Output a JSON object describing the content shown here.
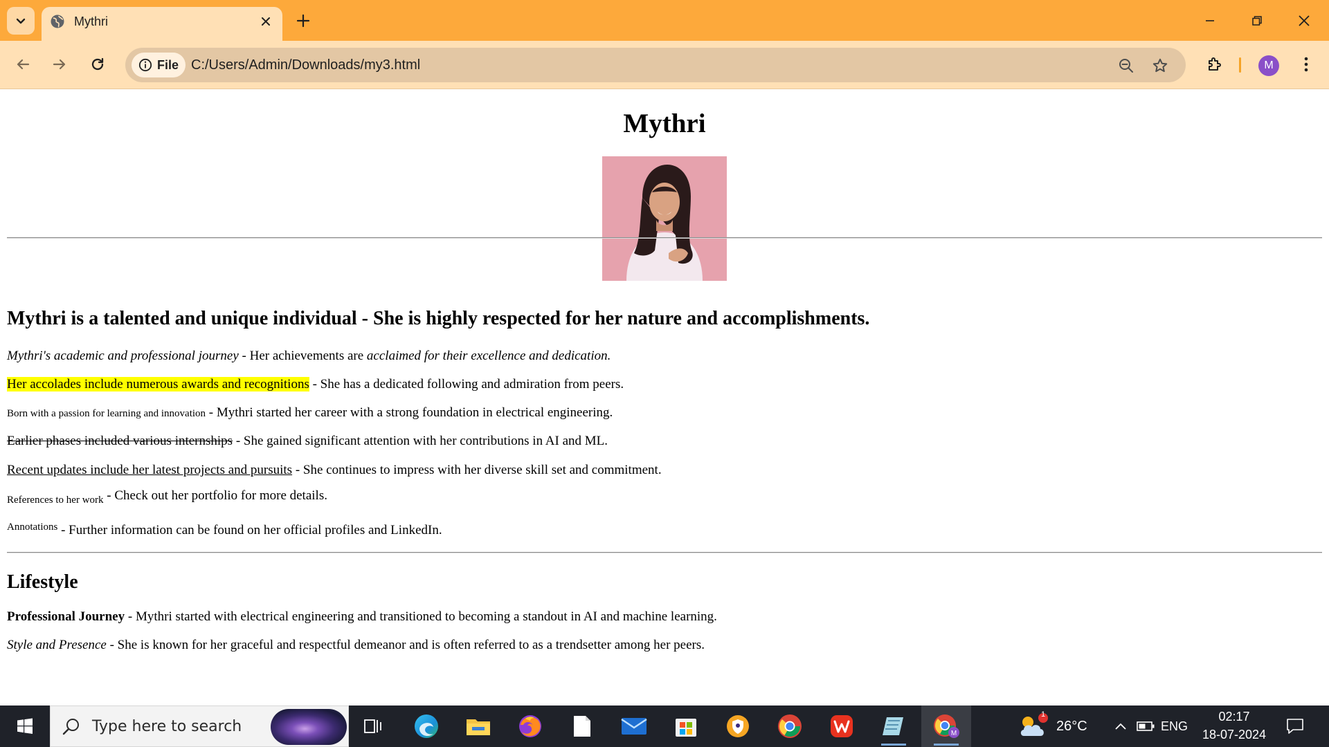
{
  "browser": {
    "tab": {
      "title": "Mythri"
    },
    "omnibox": {
      "chip_label": "File",
      "url": "C:/Users/Admin/Downloads/my3.html"
    },
    "profile_initial": "M"
  },
  "page": {
    "title": "Mythri",
    "headline": "Mythri is a talented and unique individual - She is highly respected for her nature and accomplishments.",
    "lines": [
      {
        "lead": "Mythri's academic and professional journey",
        "mid": " - Her achievements are ",
        "tail": "acclaimed for their excellence and dedication."
      },
      {
        "lead": "Her accolades include numerous awards and recognitions",
        "rest": " - She has a dedicated following and admiration from peers."
      },
      {
        "lead": "Born with a passion for learning and innovation",
        "rest": " - Mythri started her career with a strong foundation in electrical engineering."
      },
      {
        "lead": "Earlier phases included various internships",
        "rest": " - She gained significant attention with her contributions in AI and ML."
      },
      {
        "lead": "Recent updates include her latest projects and pursuits",
        "rest": " - She continues to impress with her diverse skill set and commitment."
      },
      {
        "lead": "References to her work",
        "rest": " - Check out her portfolio for more details."
      },
      {
        "lead": "Annotations",
        "rest": " - Further information can be found on her official profiles and LinkedIn."
      }
    ],
    "lifestyle": {
      "heading": "Lifestyle",
      "items": [
        {
          "label": "Professional Journey",
          "text": " - Mythri started with electrical engineering and transitioned to becoming a standout in AI and machine learning."
        },
        {
          "label": "Style and Presence",
          "text": " - She is known for her graceful and respectful demeanor and is often referred to as a trendsetter among her peers."
        }
      ]
    }
  },
  "taskbar": {
    "search_placeholder": "Type here to search",
    "weather": {
      "temp": "26°C",
      "badge": "1"
    },
    "language": "ENG",
    "time": "02:17",
    "date": "18-07-2024"
  },
  "colors": {
    "titlebar": "#fda93b",
    "toolbar": "#ffe0b5",
    "highlight": "#ffff00",
    "taskbar": "#1f2229"
  }
}
